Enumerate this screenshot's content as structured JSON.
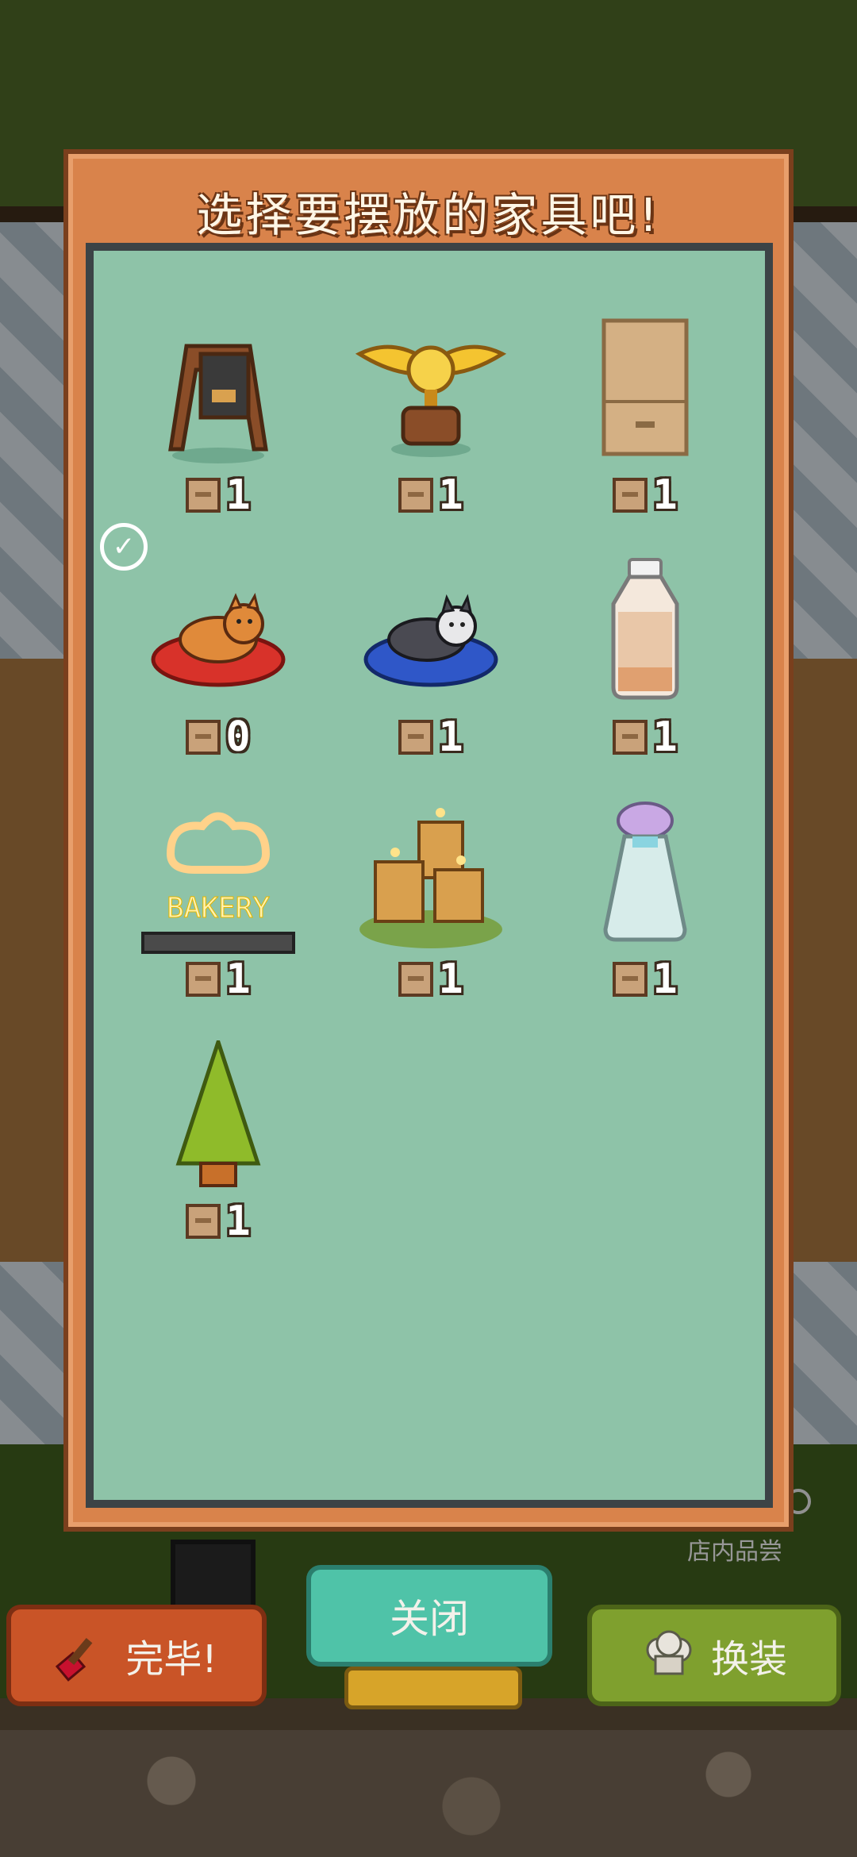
{
  "modal": {
    "title": "选择要摆放的家具吧!"
  },
  "items": [
    {
      "name": "a-frame-signboard",
      "count": "1",
      "placed": false
    },
    {
      "name": "golden-trophy",
      "count": "1",
      "placed": false
    },
    {
      "name": "cardboard-box-shelf",
      "count": "1",
      "placed": false
    },
    {
      "name": "shiba-dog-bed",
      "count": "0",
      "placed": true
    },
    {
      "name": "husky-dog-bed",
      "count": "1",
      "placed": false
    },
    {
      "name": "milk-bottle",
      "count": "1",
      "placed": false
    },
    {
      "name": "bakery-neon-sign",
      "count": "1",
      "placed": false,
      "sign_text": "BAKERY"
    },
    {
      "name": "candle-stumps",
      "count": "1",
      "placed": false
    },
    {
      "name": "salt-shaker",
      "count": "1",
      "placed": false
    },
    {
      "name": "pine-tree",
      "count": "1",
      "placed": false
    }
  ],
  "buttons": {
    "done": "完毕!",
    "close": "关闭",
    "dress": "换装"
  },
  "store_label": "店内品尝",
  "colors": {
    "modal_frame": "#d9834b",
    "panel": "#8ec3a8",
    "close_button": "#4fc3a8",
    "done_button": "#c95427",
    "dress_button": "#7fa02e"
  }
}
